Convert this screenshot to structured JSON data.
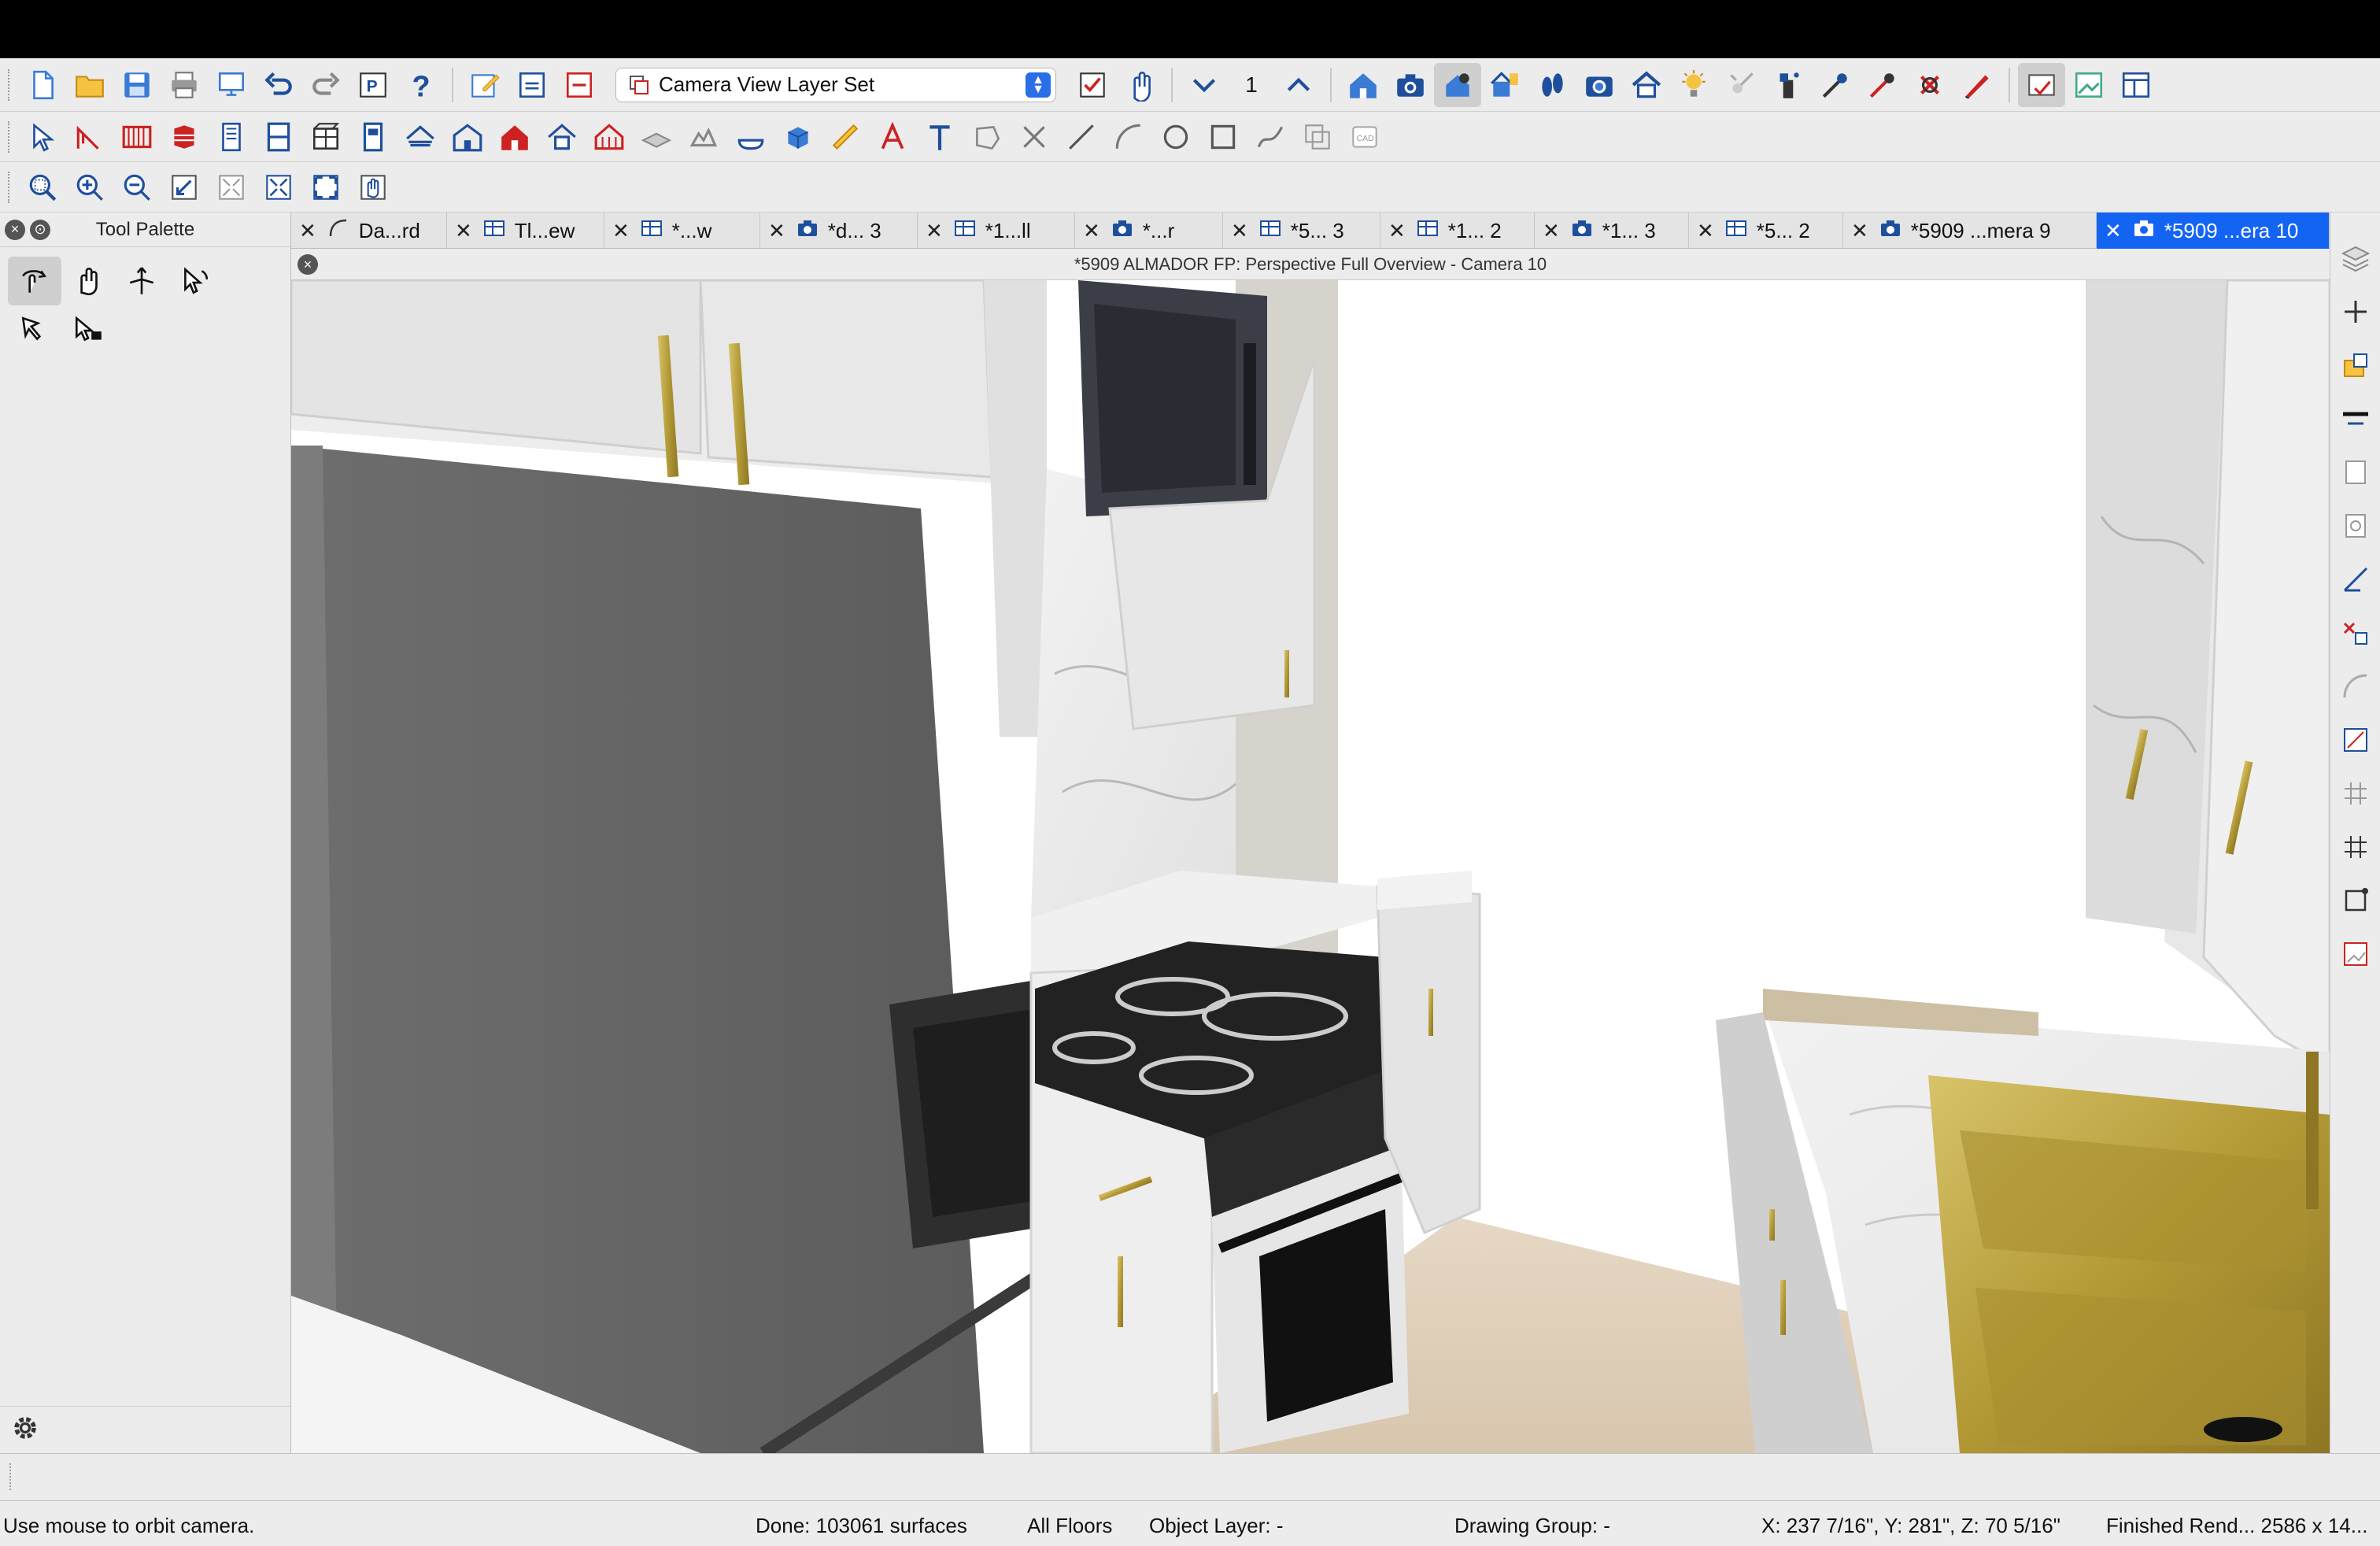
{
  "toolbar": {
    "layer_set": "Camera View Layer Set",
    "floor_number": "1"
  },
  "palette": {
    "title": "Tool Palette"
  },
  "tabs": [
    {
      "label": "Da...rd",
      "icon": "arc-icon"
    },
    {
      "label": "Tl...ew",
      "icon": "plan-view-icon"
    },
    {
      "label": "*...w",
      "icon": "plan-view-icon"
    },
    {
      "label": "*d... 3",
      "icon": "camera-icon"
    },
    {
      "label": "*1...ll",
      "icon": "plan-view-icon"
    },
    {
      "label": "*...r",
      "icon": "camera-icon"
    },
    {
      "label": "*5... 3",
      "icon": "plan-view-icon"
    },
    {
      "label": "*1... 2",
      "icon": "plan-view-icon"
    },
    {
      "label": "*1... 3",
      "icon": "camera-icon"
    },
    {
      "label": "*5... 2",
      "icon": "plan-view-icon"
    },
    {
      "label": "*5909 ...mera 9",
      "icon": "camera-icon"
    },
    {
      "label": "*5909 ...era 10",
      "icon": "camera-icon",
      "active": true
    }
  ],
  "view": {
    "title": "*5909 ALMADOR FP: Perspective Full Overview - Camera 10"
  },
  "status": {
    "hint": "Use mouse to orbit camera.",
    "done": "Done:  103061 surfaces",
    "floors": "All Floors",
    "object_layer": "Object Layer: -",
    "drawing_group": "Drawing Group: -",
    "coords": "X: 237 7/16\", Y: 281\", Z: 70 5/16\"",
    "render": "Finished Rend...   2586 x 14..."
  },
  "colors": {
    "accent": "#1464f4",
    "chrome": "#ececec",
    "brass": "#b8972e"
  }
}
